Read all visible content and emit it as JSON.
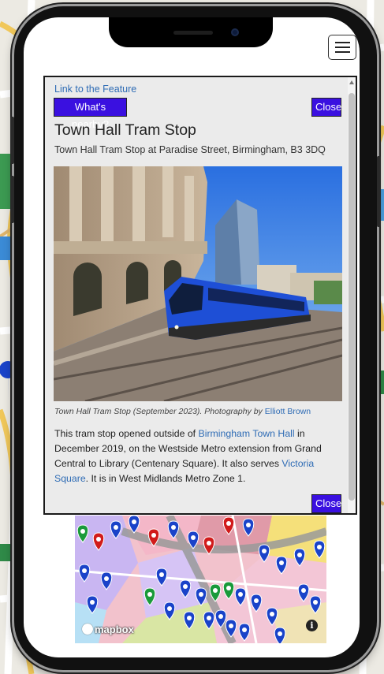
{
  "popup": {
    "feature_link": "Link to the Feature",
    "nearby_button": "What's nearby?",
    "close_top": "Close",
    "title": "Town Hall Tram Stop",
    "address": "Town Hall Tram Stop at Paradise Street, Birmingham, B3 3DQ",
    "caption_text": "Town Hall Tram Stop (September 2023). Photography by ",
    "caption_author": "Elliott Brown",
    "desc_1": "This tram stop opened outside of ",
    "desc_link_1": "Birmingham Town Hall",
    "desc_2": " in December 2019, on the Westside Metro extension from Grand Central to Library (Centenary Square). It also serves ",
    "desc_link_2": "Victoria Square",
    "desc_3": ". It is in West Midlands Metro Zone 1.",
    "close_bottom": "Close"
  },
  "map": {
    "attribution_logo": "mapbox",
    "info_icon": "i",
    "colors": {
      "tram_blue": "#1e4fd6",
      "button_purple": "#3a10e0",
      "link_blue": "#2f6cb5",
      "pin_blue": "#1a43c9",
      "pin_red": "#d11b1b",
      "pin_green": "#1a9a3a"
    }
  },
  "icons": [
    "hamburger-menu-icon",
    "info-icon",
    "map-pin-icon"
  ]
}
